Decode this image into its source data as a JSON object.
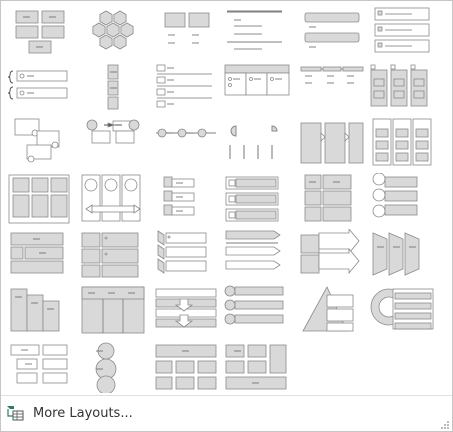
{
  "gallery": {
    "rows": [
      [
        "basic-block-list",
        "hexagon-cluster",
        "grouped-list",
        "vertical-bullet-list",
        "vertical-box-list",
        "stacked-list"
      ],
      [
        "bracket-list",
        "vertical-chevron-list",
        "horizontal-bullet-list",
        "table-list",
        "lined-list",
        "vertical-arrow-list"
      ],
      [
        "picture-caption-list",
        "alternating-hexagons",
        "timeline-list",
        "pie-list",
        "segmented-process",
        "tab-list"
      ],
      [
        "picture-grid",
        "picture-accent-list",
        "labeled-hierarchy",
        "checkbox-list",
        "block-matrix",
        "circle-picture-list"
      ],
      [
        "table-hierarchy",
        "detailed-process",
        "chevron-list",
        "arrow-ribbon-list",
        "callout-arrows",
        "trapezoid-list"
      ],
      [
        "staggered-columns",
        "column-table",
        "arrow-process-table",
        "circle-bullet-list",
        "triangle-pyramid",
        "circle-table-list"
      ],
      [
        "hierarchy-list",
        "circle-accent-list",
        "row-table",
        "block-table"
      ]
    ],
    "stroke_color": "#8a8a8a",
    "fill_color": "#d9d9d9"
  },
  "footer": {
    "more_layouts_label": "More Layouts...",
    "icon": "smartart-layouts-icon"
  }
}
